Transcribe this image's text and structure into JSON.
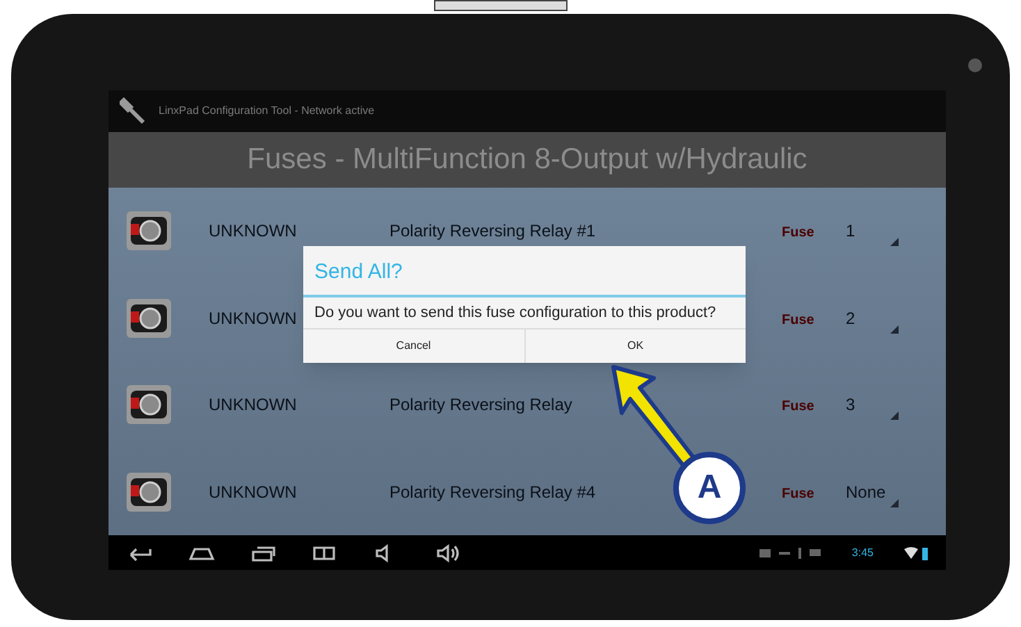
{
  "window": {
    "title": "LinxPad Configuration Tool - Network active"
  },
  "header": {
    "title": "Fuses - MultiFunction 8-Output w/Hydraulic"
  },
  "rows": [
    {
      "product": "UNKNOWN",
      "name": "Polarity Reversing Relay #1",
      "fuse_label": "Fuse",
      "value": "1"
    },
    {
      "product": "UNKNOWN",
      "fuse_label": "Fuse",
      "value": "2"
    },
    {
      "product": "UNKNOWN",
      "name": "Polarity Reversing Relay",
      "fuse_label": "Fuse",
      "value": "3"
    },
    {
      "product": "UNKNOWN",
      "name": "Polarity Reversing Relay #4",
      "fuse_label": "Fuse",
      "value": "None"
    }
  ],
  "dialog": {
    "title": "Send All?",
    "message": "Do you want to send this fuse configuration to this product?",
    "buttons": [
      "Cancel",
      "OK"
    ]
  },
  "callout": {
    "label": "A"
  },
  "status_bar": {
    "time": "3:45"
  }
}
